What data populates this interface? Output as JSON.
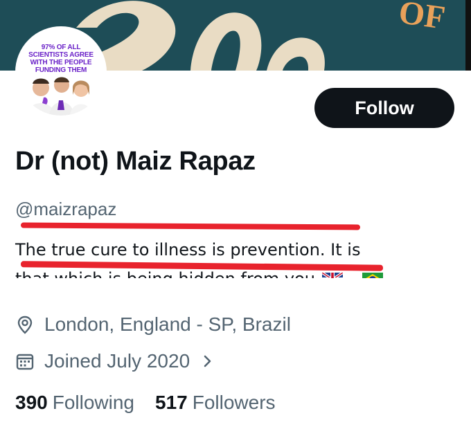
{
  "banner": {
    "text": "OF"
  },
  "avatar": {
    "caption": "97% OF ALL SCIENTISTS AGREE WITH THE PEOPLE FUNDING THEM"
  },
  "profile": {
    "follow_label": "Follow",
    "display_name": "Dr (not) Maiz Rapaz",
    "handle": "@maizrapaz",
    "bio_line1": "The true cure to illness is prevention. It is",
    "bio_line2_text": "that which is being hidden from you",
    "bio_line2_sep": "-",
    "location": "London, England - SP, Brazil",
    "joined": "Joined July 2020",
    "following_count": "390",
    "following_label": "Following",
    "followers_count": "517",
    "followers_label": "Followers"
  },
  "icons": {
    "location": "location-pin-icon",
    "calendar": "calendar-icon",
    "chevron": "chevron-right-icon",
    "flag_uk": "uk-flag-icon",
    "flag_br": "brazil-flag-icon"
  },
  "colors": {
    "banner": "#1e4d57",
    "banner_text": "#e8a15a",
    "follow_bg": "#0f1419",
    "secondary_text": "#536471",
    "underline": "#e8232d",
    "avatar_caption": "#6a22c8"
  }
}
